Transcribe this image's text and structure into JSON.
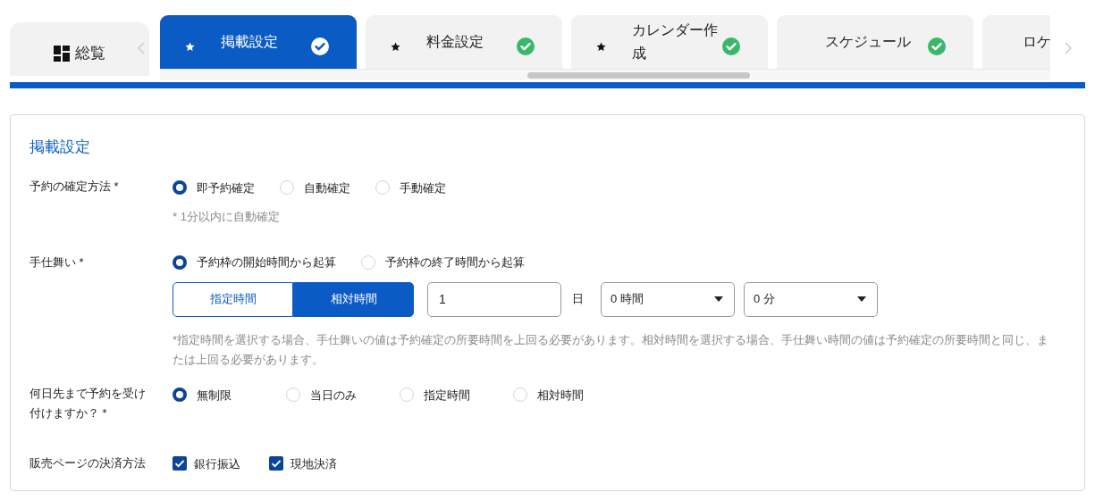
{
  "overview_tab": {
    "label": "総覧"
  },
  "tabs": [
    {
      "label": "掲載設定",
      "selected": true,
      "starred": true,
      "completed": true
    },
    {
      "label": "料金設定",
      "selected": false,
      "starred": true,
      "completed": true
    },
    {
      "label": "カレンダー作成",
      "selected": false,
      "starred": true,
      "completed": true
    },
    {
      "label": "スケジュール",
      "selected": false,
      "starred": false,
      "completed": true
    },
    {
      "label": "ロケ",
      "selected": false
    }
  ],
  "section_title": "掲載設定",
  "fields": [
    {
      "kind": "radio",
      "label": "予約の確定方法 *",
      "options": [
        {
          "label": "即予約確定",
          "selected": true
        },
        {
          "label": "自動確定",
          "selected": false
        },
        {
          "label": "手動確定",
          "selected": false
        }
      ],
      "note": "* 1分以内に自動確定"
    },
    {
      "kind": "lead_time",
      "label": "手仕舞い *",
      "options": [
        {
          "label": "予約枠の開始時間から起算",
          "selected": true
        },
        {
          "label": "予約枠の終了時間から起算",
          "selected": false
        }
      ],
      "mode_buttons": [
        {
          "label": "指定時間",
          "selected": false
        },
        {
          "label": "相対時間",
          "selected": true
        }
      ],
      "days": {
        "value": "1",
        "unit": "日"
      },
      "selects": [
        {
          "value": "0 時間"
        },
        {
          "value": "0 分"
        }
      ],
      "note": "*指定時間を選択する場合、手仕舞いの値は予約確定の所要時間を上回る必要があります。相対時間を選択する場合、手仕舞い時間の値は予約確定の所要時間と同じ、または上回る必要があります。"
    },
    {
      "kind": "radio",
      "label": "何日先まで予約を受け付けますか？ *",
      "options": [
        {
          "label": "無制限",
          "selected": true
        },
        {
          "label": "当日のみ",
          "selected": false
        },
        {
          "label": "指定時間",
          "selected": false
        },
        {
          "label": "相対時間",
          "selected": false
        }
      ]
    },
    {
      "kind": "checkbox",
      "label": "販売ページの決済方法",
      "options": [
        {
          "label": "銀行振込",
          "checked": true
        },
        {
          "label": "現地決済",
          "checked": true
        }
      ]
    }
  ]
}
